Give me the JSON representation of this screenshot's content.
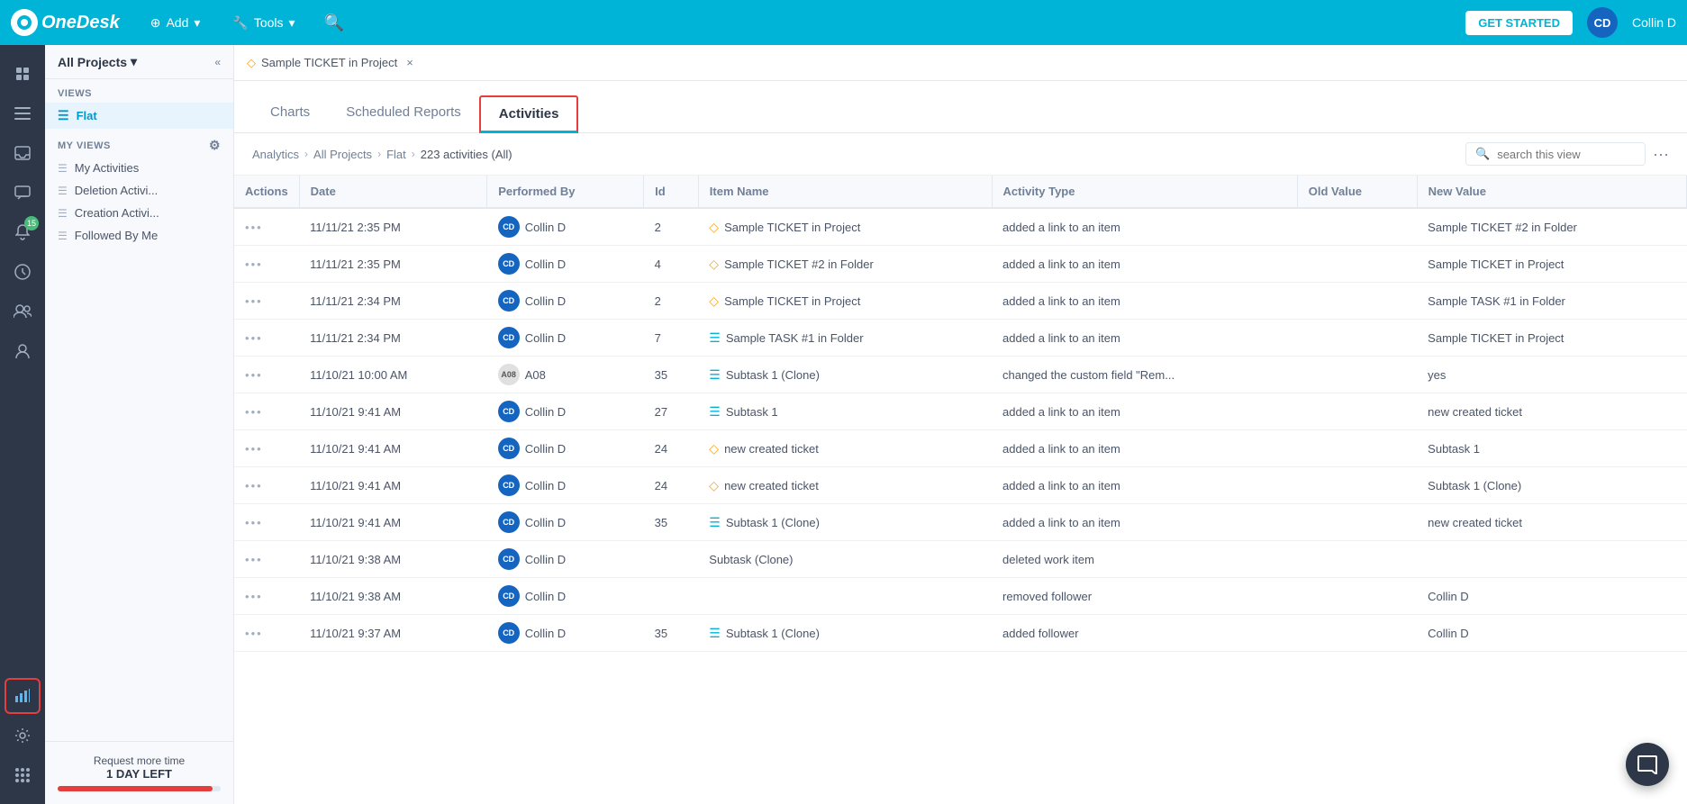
{
  "logo": {
    "text": "OneDesk",
    "initials": "O"
  },
  "topnav": {
    "add_label": "Add",
    "tools_label": "Tools",
    "get_started": "GET STARTED",
    "user_initials": "CD",
    "user_name": "Collin D"
  },
  "sidebar": {
    "all_projects": "All Projects",
    "views_label": "VIEWS",
    "flat_label": "Flat",
    "my_views_label": "MY VIEWS",
    "views": [
      {
        "label": "My Activities"
      },
      {
        "label": "Deletion Activi..."
      },
      {
        "label": "Creation Activi..."
      },
      {
        "label": "Followed By Me"
      }
    ],
    "footer": {
      "request_label": "Request more time",
      "days_left": "1 DAY LEFT"
    }
  },
  "open_tab": {
    "label": "Sample TICKET in Project",
    "close": "×"
  },
  "analytics_tabs": [
    {
      "label": "Charts",
      "active": false
    },
    {
      "label": "Scheduled Reports",
      "active": false
    },
    {
      "label": "Activities",
      "active": true
    }
  ],
  "breadcrumb": {
    "analytics": "Analytics",
    "all_projects": "All Projects",
    "flat": "Flat",
    "count": "223 activities (All)"
  },
  "search": {
    "placeholder": "search this view"
  },
  "table": {
    "headers": [
      "Actions",
      "Date",
      "Performed By",
      "Id",
      "Item Name",
      "Activity Type",
      "Old Value",
      "New Value"
    ],
    "rows": [
      {
        "date": "11/11/21 2:35 PM",
        "performed_by": "Collin D",
        "avatar_type": "cd",
        "id": "2",
        "item_name": "Sample TICKET in Project",
        "item_type": "ticket",
        "activity_type": "added a link to an item",
        "old_value": "",
        "new_value": "Sample TICKET #2 in Folder"
      },
      {
        "date": "11/11/21 2:35 PM",
        "performed_by": "Collin D",
        "avatar_type": "cd",
        "id": "4",
        "item_name": "Sample TICKET #2 in Folder",
        "item_type": "ticket",
        "activity_type": "added a link to an item",
        "old_value": "",
        "new_value": "Sample TICKET in Project"
      },
      {
        "date": "11/11/21 2:34 PM",
        "performed_by": "Collin D",
        "avatar_type": "cd",
        "id": "2",
        "item_name": "Sample TICKET in Project",
        "item_type": "ticket",
        "activity_type": "added a link to an item",
        "old_value": "",
        "new_value": "Sample TASK #1 in Folder"
      },
      {
        "date": "11/11/21 2:34 PM",
        "performed_by": "Collin D",
        "avatar_type": "cd",
        "id": "7",
        "item_name": "Sample TASK #1 in Folder",
        "item_type": "task",
        "activity_type": "added a link to an item",
        "old_value": "",
        "new_value": "Sample TICKET in Project"
      },
      {
        "date": "11/10/21 10:00 AM",
        "performed_by": "A08",
        "avatar_type": "a08",
        "id": "35",
        "item_name": "Subtask 1 (Clone)",
        "item_type": "task",
        "activity_type": "changed the custom field \"Rem...",
        "old_value": "",
        "new_value": "yes"
      },
      {
        "date": "11/10/21 9:41 AM",
        "performed_by": "Collin D",
        "avatar_type": "cd",
        "id": "27",
        "item_name": "Subtask 1",
        "item_type": "task",
        "activity_type": "added a link to an item",
        "old_value": "",
        "new_value": "new created ticket"
      },
      {
        "date": "11/10/21 9:41 AM",
        "performed_by": "Collin D",
        "avatar_type": "cd",
        "id": "24",
        "item_name": "new created ticket",
        "item_type": "ticket",
        "activity_type": "added a link to an item",
        "old_value": "",
        "new_value": "Subtask 1"
      },
      {
        "date": "11/10/21 9:41 AM",
        "performed_by": "Collin D",
        "avatar_type": "cd",
        "id": "24",
        "item_name": "new created ticket",
        "item_type": "ticket",
        "activity_type": "added a link to an item",
        "old_value": "",
        "new_value": "Subtask 1 (Clone)"
      },
      {
        "date": "11/10/21 9:41 AM",
        "performed_by": "Collin D",
        "avatar_type": "cd",
        "id": "35",
        "item_name": "Subtask 1 (Clone)",
        "item_type": "task",
        "activity_type": "added a link to an item",
        "old_value": "",
        "new_value": "new created ticket"
      },
      {
        "date": "11/10/21 9:38 AM",
        "performed_by": "Collin D",
        "avatar_type": "cd",
        "id": "",
        "item_name": "Subtask (Clone)",
        "item_type": "none",
        "activity_type": "deleted work item",
        "old_value": "",
        "new_value": ""
      },
      {
        "date": "11/10/21 9:38 AM",
        "performed_by": "Collin D",
        "avatar_type": "cd",
        "id": "",
        "item_name": "",
        "item_type": "none",
        "activity_type": "removed follower",
        "old_value": "",
        "new_value": "Collin D"
      },
      {
        "date": "11/10/21 9:37 AM",
        "performed_by": "Collin D",
        "avatar_type": "cd",
        "id": "35",
        "item_name": "Subtask 1 (Clone)",
        "item_type": "task",
        "activity_type": "added follower",
        "old_value": "",
        "new_value": "Collin D"
      }
    ]
  }
}
